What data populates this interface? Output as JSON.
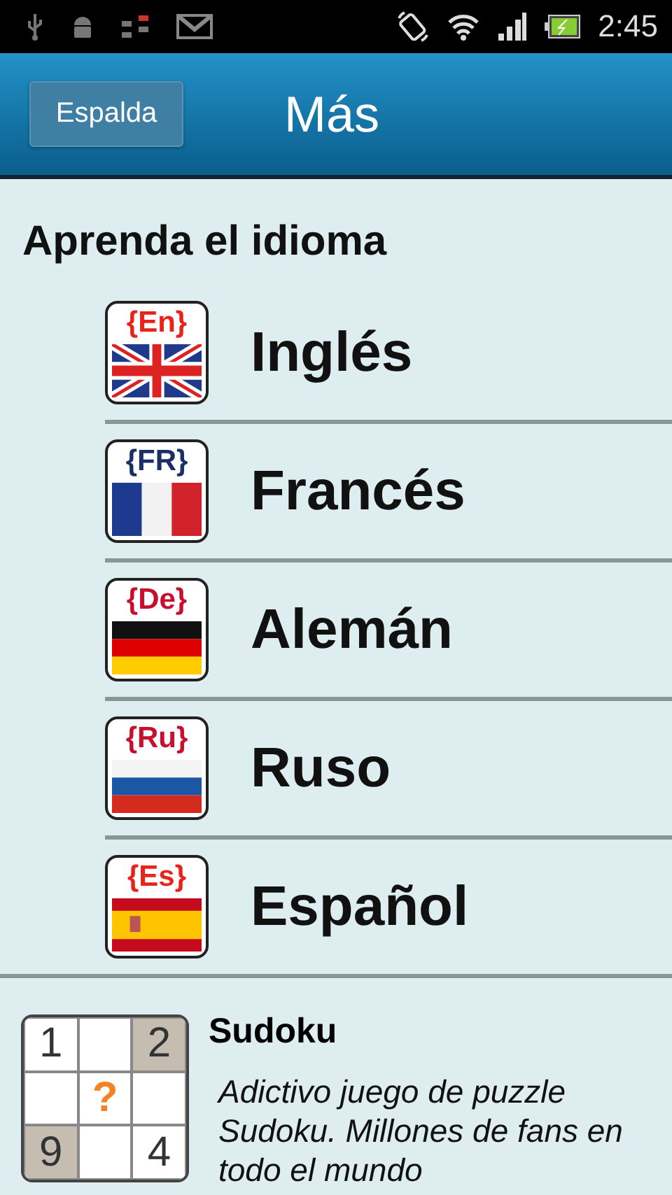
{
  "status_bar": {
    "time": "2:45"
  },
  "header": {
    "back_button": "Espalda",
    "title": "Más"
  },
  "section": {
    "heading": "Aprenda el idioma"
  },
  "languages": [
    {
      "name": "Inglés",
      "code": "{En}",
      "kind": "uk",
      "color": "#e8231a"
    },
    {
      "name": "Francés",
      "code": "{FR}",
      "kind": "fr",
      "color": "#1a2f66"
    },
    {
      "name": "Alemán",
      "code": "{De}",
      "kind": "de",
      "color": "#c8102e"
    },
    {
      "name": "Ruso",
      "code": "{Ru}",
      "kind": "ru",
      "color": "#c8102e"
    },
    {
      "name": "Español",
      "code": "{Es}",
      "kind": "es",
      "color": "#e8231a"
    }
  ],
  "promo": {
    "title": "Sudoku",
    "description": "Adictivo juego de puzzle Sudoku. Millones de fans en todo el mundo",
    "cells": [
      {
        "text": "1",
        "kind": "given",
        "shaded": false
      },
      {
        "kind": "empty",
        "shaded": false
      },
      {
        "text": "2",
        "kind": "given",
        "shaded": true
      },
      {
        "kind": "empty",
        "shaded": false
      },
      {
        "text": "?",
        "kind": "hint",
        "shaded": false
      },
      {
        "kind": "empty",
        "shaded": false
      },
      {
        "text": "9",
        "kind": "given",
        "shaded": true
      },
      {
        "kind": "empty",
        "shaded": false
      },
      {
        "text": "4",
        "kind": "given",
        "shaded": false
      }
    ]
  }
}
